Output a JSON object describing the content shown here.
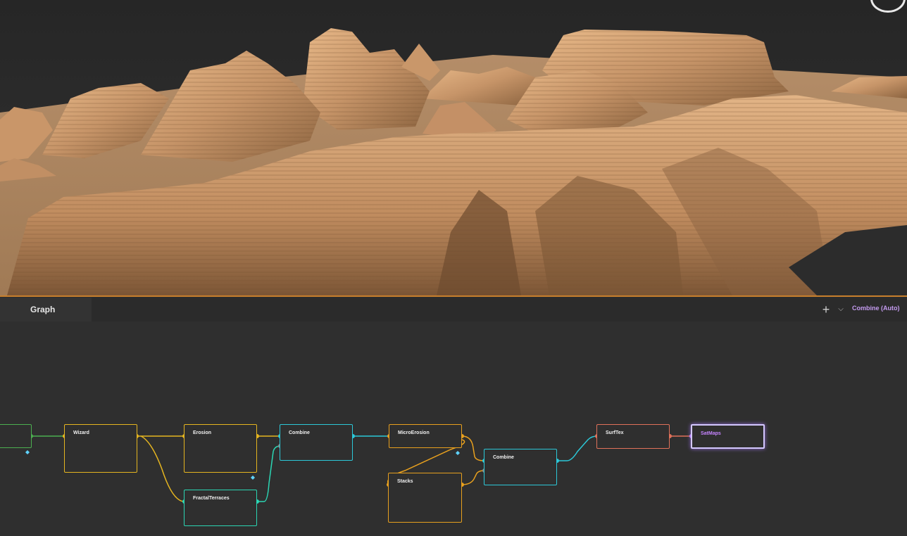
{
  "panel": {
    "tab_label": "Graph",
    "active_node": "Combine (Auto)"
  },
  "nodes": [
    {
      "id": "input",
      "title": "",
      "color": "#4caf50"
    },
    {
      "id": "wizard",
      "title": "Wizard",
      "color": "#e5b520"
    },
    {
      "id": "erosion",
      "title": "Erosion",
      "color": "#e5b520"
    },
    {
      "id": "fractal",
      "title": "FractalTerraces",
      "color": "#2bd6b4"
    },
    {
      "id": "combine1",
      "title": "Combine",
      "color": "#2cc8d8"
    },
    {
      "id": "microerosion",
      "title": "MicroErosion",
      "color": "#e8a01e"
    },
    {
      "id": "stacks",
      "title": "Stacks",
      "color": "#e8a01e"
    },
    {
      "id": "combine2",
      "title": "Combine",
      "color": "#2cc8d8"
    },
    {
      "id": "surftex",
      "title": "SurfTex",
      "color": "#e0715a"
    },
    {
      "id": "satmaps",
      "title": "SatMaps",
      "color": "#d4c8ff"
    }
  ],
  "colors": {
    "accent": "#c87f2c",
    "selection": "#c684ff",
    "sand": "#d9a878"
  }
}
